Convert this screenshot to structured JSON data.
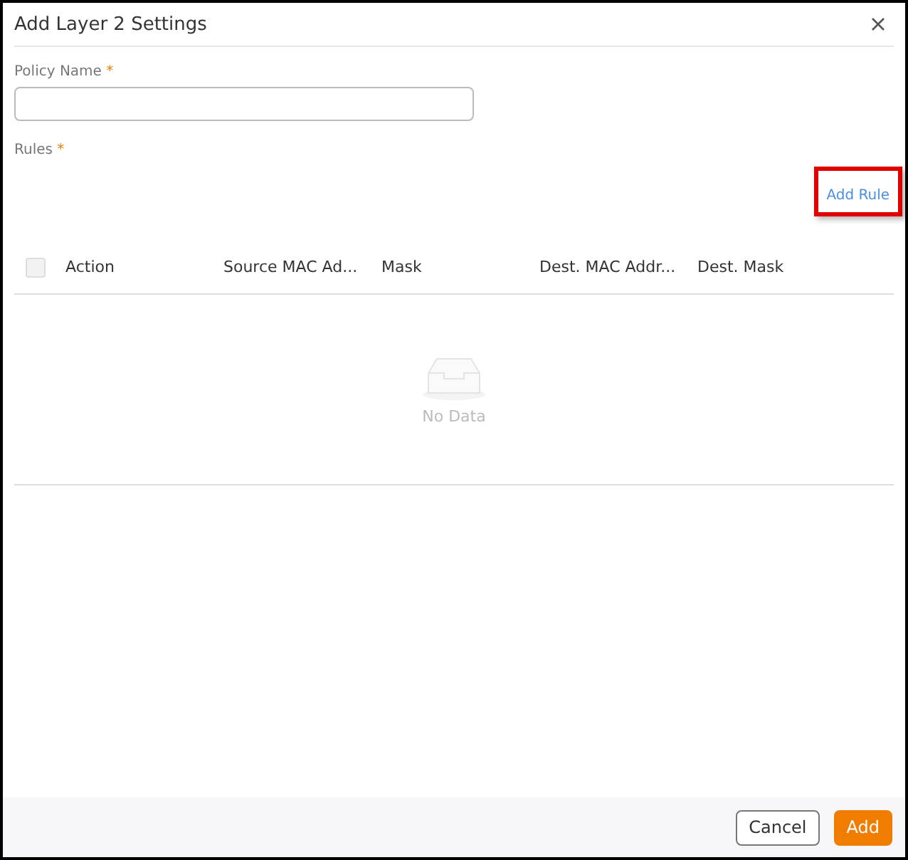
{
  "window": {
    "title": "Add Layer 2 Settings"
  },
  "policy_name": {
    "label": "Policy Name",
    "required_mark": "*"
  },
  "rules": {
    "label": "Rules",
    "required_mark": "*",
    "add_link": "Add Rule",
    "highlighted": true
  },
  "table": {
    "select_all_checked": false,
    "columns": [
      "Action",
      "Source MAC Ad...",
      "Mask",
      "Dest. MAC Addr...",
      "Dest. Mask"
    ],
    "empty_text": "No Data"
  },
  "buttons": [
    {
      "label": "Cancel",
      "kind": "secondary"
    },
    {
      "label": "Add",
      "kind": "primary"
    }
  ]
}
